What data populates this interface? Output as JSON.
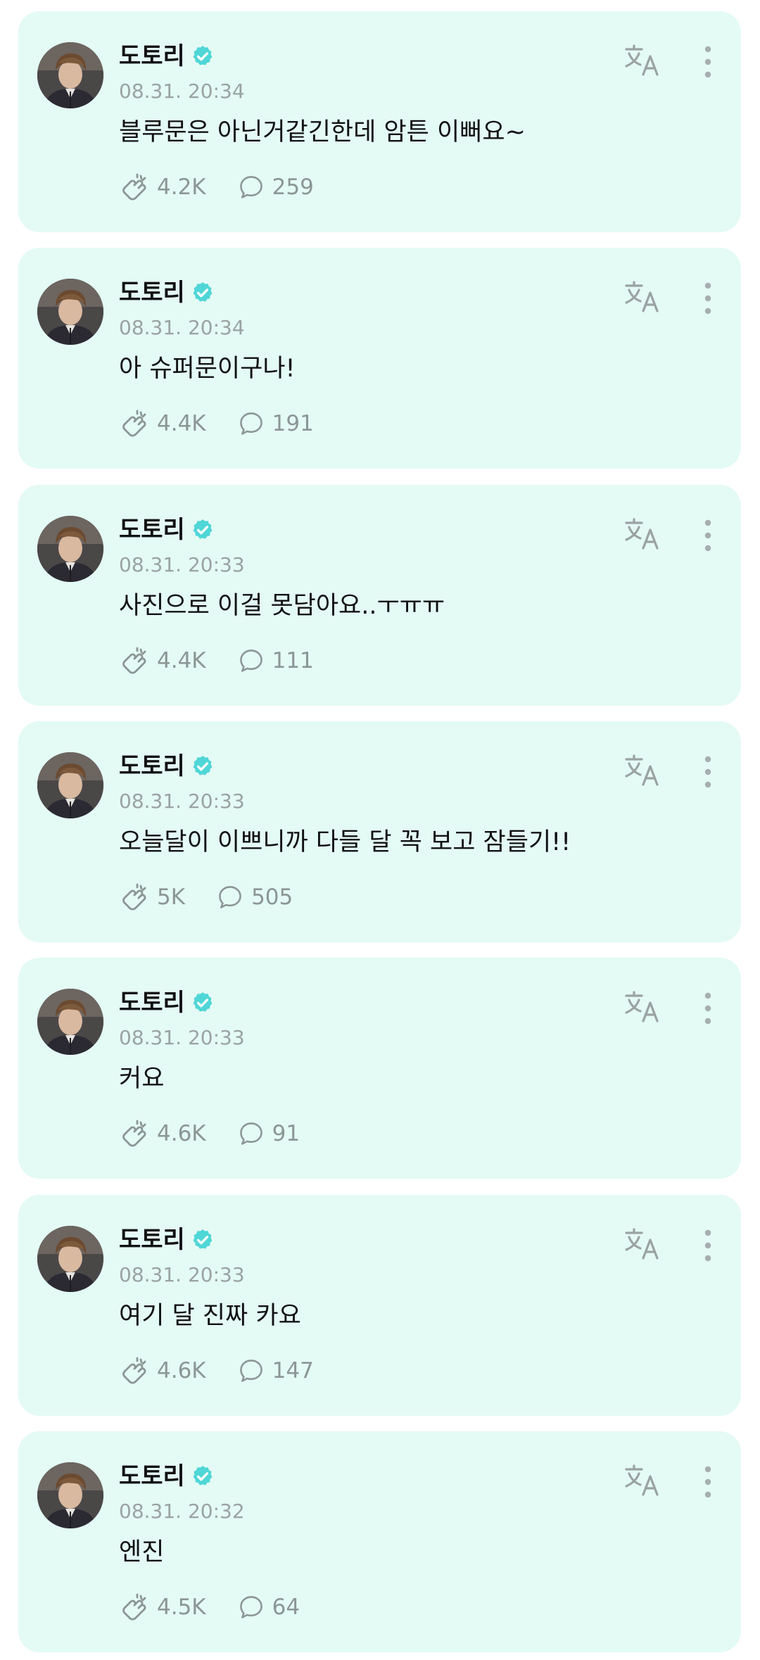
{
  "colors": {
    "card_background": "#e4faf5",
    "verified_badge": "#4fd6d6",
    "muted_text": "#9aa3a2",
    "primary_text": "#111111"
  },
  "icons": {
    "verified": "verified-badge-icon",
    "translate": "translate-icon",
    "more": "more-vertical-icon",
    "cheer": "cheer-hand-icon",
    "comment": "comment-bubble-icon"
  },
  "posts": [
    {
      "author": "도토리",
      "time": "08.31. 20:34",
      "text": "블루문은 아닌거같긴한데 암튼 이뻐요~",
      "likes": "4.2K",
      "comments": "259"
    },
    {
      "author": "도토리",
      "time": "08.31. 20:34",
      "text": "아 슈퍼문이구나!",
      "likes": "4.4K",
      "comments": "191"
    },
    {
      "author": "도토리",
      "time": "08.31. 20:33",
      "text": "사진으로 이걸 못담아요..ㅜㅠㅠ",
      "likes": "4.4K",
      "comments": "111"
    },
    {
      "author": "도토리",
      "time": "08.31. 20:33",
      "text": "오늘달이 이쁘니까 다들 달 꼭 보고 잠들기!!",
      "likes": "5K",
      "comments": "505"
    },
    {
      "author": "도토리",
      "time": "08.31. 20:33",
      "text": "커요",
      "likes": "4.6K",
      "comments": "91"
    },
    {
      "author": "도토리",
      "time": "08.31. 20:33",
      "text": "여기 달 진짜 카요",
      "likes": "4.6K",
      "comments": "147"
    },
    {
      "author": "도토리",
      "time": "08.31. 20:32",
      "text": "엔진",
      "likes": "4.5K",
      "comments": "64"
    }
  ]
}
